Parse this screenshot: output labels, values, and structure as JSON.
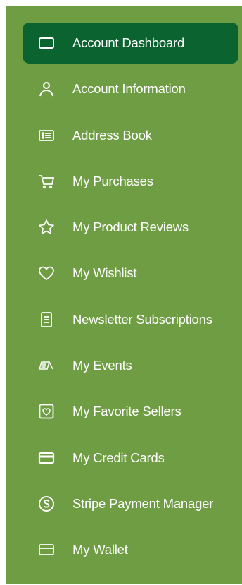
{
  "sidebar": {
    "active_index": 0,
    "items": [
      {
        "label": "Account Dashboard",
        "icon": "dashboard-icon"
      },
      {
        "label": "Account Information",
        "icon": "user-icon"
      },
      {
        "label": "Address Book",
        "icon": "address-card-icon"
      },
      {
        "label": "My Purchases",
        "icon": "cart-icon"
      },
      {
        "label": "My Product Reviews",
        "icon": "star-icon"
      },
      {
        "label": "My Wishlist",
        "icon": "heart-icon"
      },
      {
        "label": "Newsletter Subscriptions",
        "icon": "document-icon"
      },
      {
        "label": "My Events",
        "icon": "ticket-icon"
      },
      {
        "label": "My Favorite Sellers",
        "icon": "heart-box-icon"
      },
      {
        "label": "My Credit Cards",
        "icon": "credit-card-icon"
      },
      {
        "label": "Stripe Payment Manager",
        "icon": "stripe-icon"
      },
      {
        "label": "My Wallet",
        "icon": "wallet-icon"
      }
    ]
  },
  "colors": {
    "panel_bg": "#6e9d43",
    "active_bg": "#0b6330",
    "text": "#ffffff"
  }
}
